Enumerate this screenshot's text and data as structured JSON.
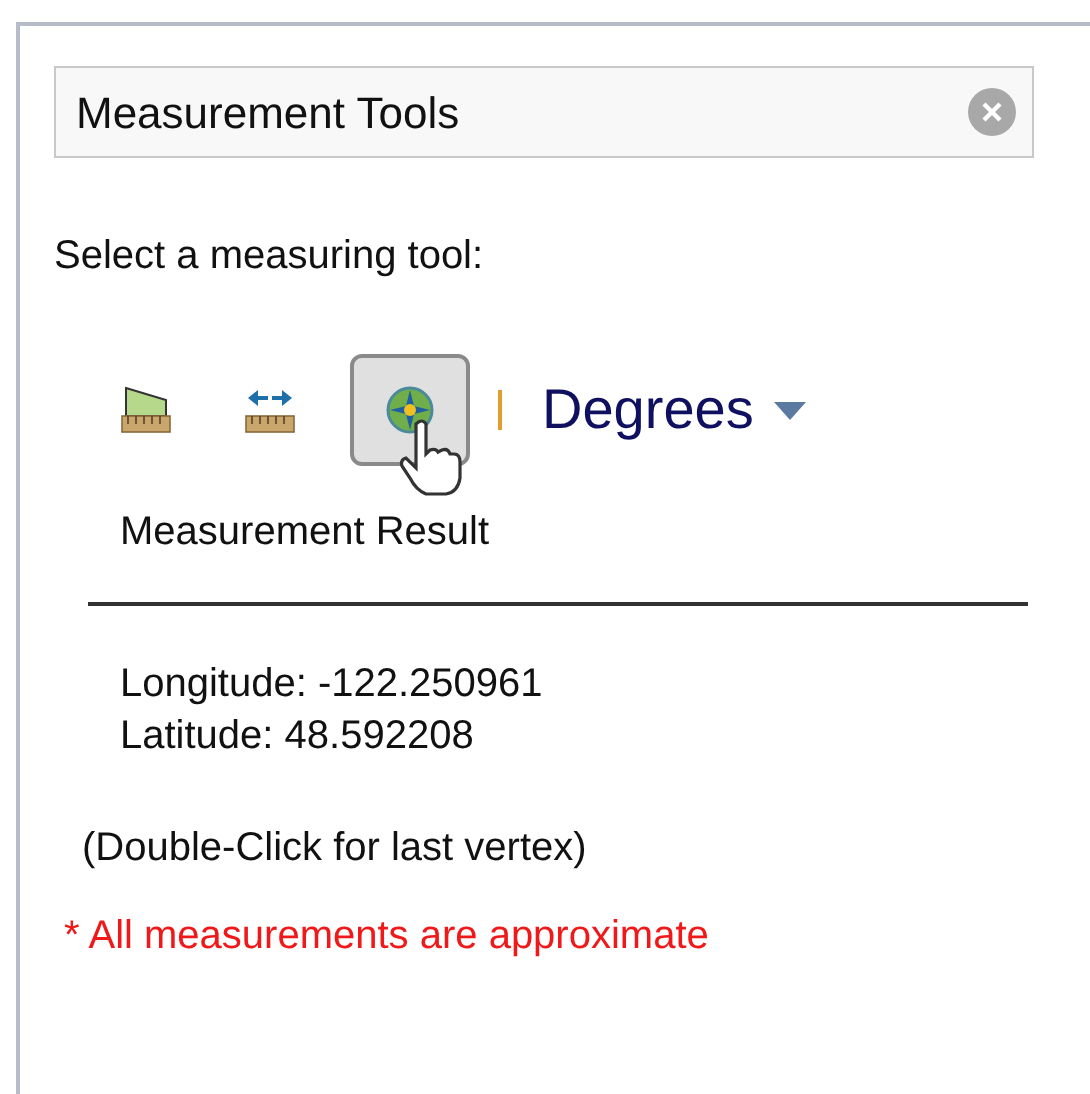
{
  "panel": {
    "title": "Measurement Tools"
  },
  "prompt": "Select a measuring tool:",
  "tools": [
    {
      "kind": "area",
      "selected": false
    },
    {
      "kind": "distance",
      "selected": false
    },
    {
      "kind": "location",
      "selected": true
    }
  ],
  "units": {
    "value": "Degrees"
  },
  "result": {
    "heading": "Measurement Result",
    "lines": [
      "Longitude: -122.250961",
      "Latitude: 48.592208"
    ]
  },
  "hint": "(Double-Click for last vertex)",
  "note": "* All measurements are approximate"
}
